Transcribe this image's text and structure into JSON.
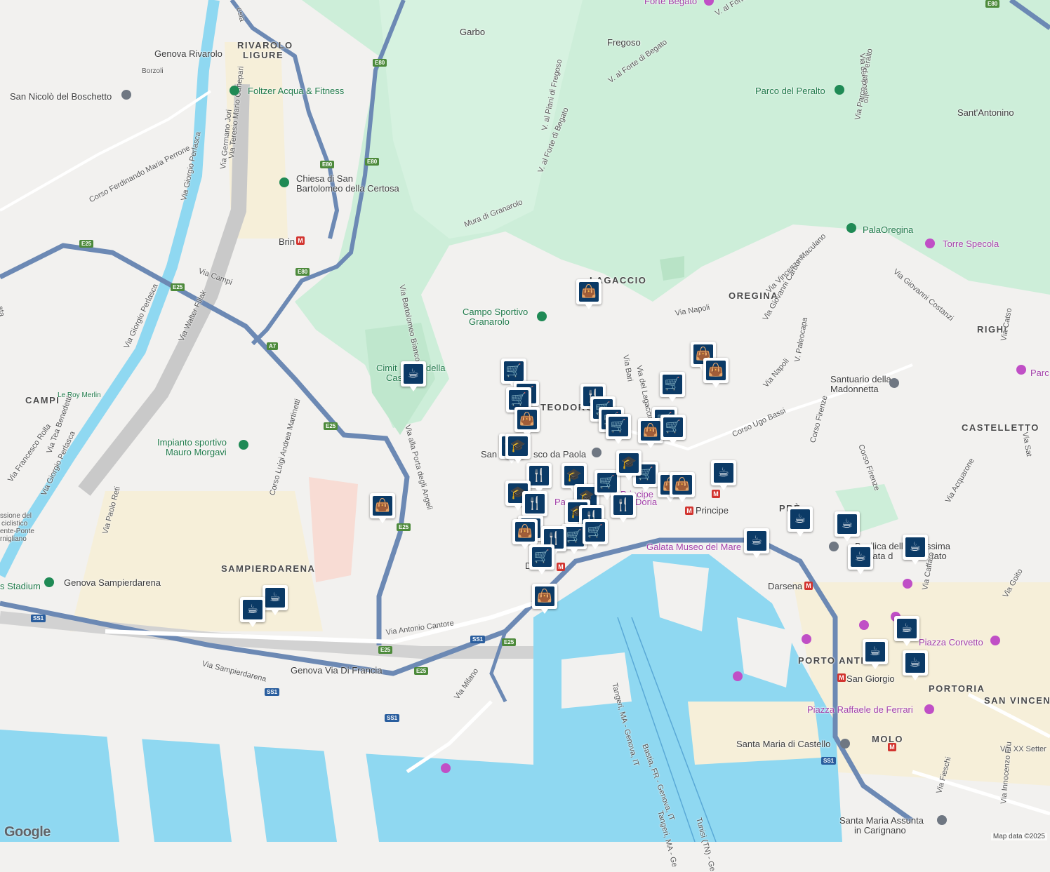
{
  "map": {
    "colors": {
      "land": "#f2f1ef",
      "park": "#c8ecd6",
      "water": "#8ed8f0",
      "highway": "#6f8fb8",
      "major_road": "#ffffff",
      "urban": "#f5efdc"
    },
    "labels": [
      {
        "id": "garbo",
        "text": "Garbo",
        "kind": "place"
      },
      {
        "id": "fregoso",
        "text": "Fregoso",
        "kind": "place"
      },
      {
        "id": "forte-begato",
        "text": "Forte Begato",
        "kind": "purple"
      },
      {
        "id": "rivarolo",
        "text": "RIVAROLO",
        "kind": "area"
      },
      {
        "id": "ligure",
        "text": "LIGURE",
        "kind": "area"
      },
      {
        "id": "genova-rivarolo",
        "text": "Genova Rivarolo",
        "kind": "place"
      },
      {
        "id": "borzoli",
        "text": "Borzoli",
        "kind": "small"
      },
      {
        "id": "san-nicolo",
        "text": "San Nicolò del Boschetto",
        "kind": "place"
      },
      {
        "id": "foltzer",
        "text": "Foltzer Acqua & Fitness",
        "kind": "green"
      },
      {
        "id": "chiesa1",
        "text": "Chiesa di San",
        "kind": "place"
      },
      {
        "id": "chiesa2",
        "text": "Bartolomeo della Certosa",
        "kind": "place"
      },
      {
        "id": "brin",
        "text": "Brin",
        "kind": "place"
      },
      {
        "id": "parco-peralto",
        "text": "Parco del Peralto",
        "kind": "green"
      },
      {
        "id": "sant-antonino",
        "text": "Sant'Antonino",
        "kind": "place"
      },
      {
        "id": "palaoregina",
        "text": "PalaOregina",
        "kind": "green"
      },
      {
        "id": "torre-specola",
        "text": "Torre Specola",
        "kind": "purple"
      },
      {
        "id": "lagaccio",
        "text": "LAGACCIO",
        "kind": "area"
      },
      {
        "id": "oregina",
        "text": "OREGINA",
        "kind": "area"
      },
      {
        "id": "righi",
        "text": "RIGHI",
        "kind": "area"
      },
      {
        "id": "campo1",
        "text": "Campo Sportivo",
        "kind": "green"
      },
      {
        "id": "campo2",
        "text": "Granarolo",
        "kind": "green"
      },
      {
        "id": "cimit",
        "text": "Cimit",
        "kind": "green"
      },
      {
        "id": "della",
        "text": "della",
        "kind": "green"
      },
      {
        "id": "cas",
        "text": "Cas",
        "kind": "green"
      },
      {
        "id": "campi",
        "text": "CAMPI",
        "kind": "area"
      },
      {
        "id": "leroy",
        "text": "Le Roy Merlin",
        "kind": "small-green"
      },
      {
        "id": "teodoro",
        "text": "TEODORO",
        "kind": "area"
      },
      {
        "id": "santuario1",
        "text": "Santuario della",
        "kind": "place"
      },
      {
        "id": "santuario2",
        "text": "Madonnetta",
        "kind": "place"
      },
      {
        "id": "castelletto",
        "text": "CASTELLETTO",
        "kind": "area"
      },
      {
        "id": "impianto1",
        "text": "Impianto sportivo",
        "kind": "green"
      },
      {
        "id": "impianto2",
        "text": "Mauro Morgavi",
        "kind": "green"
      },
      {
        "id": "san-fran",
        "text": "San",
        "kind": "place"
      },
      {
        "id": "sco-paola",
        "text": "sco da Paola",
        "kind": "place"
      },
      {
        "id": "pa-principe",
        "text": "Pa",
        "kind": "purple"
      },
      {
        "id": "doria",
        "text": "Doria",
        "kind": "purple"
      },
      {
        "id": "principe-top",
        "text": "Principe",
        "kind": "purple"
      },
      {
        "id": "principe",
        "text": "Principe",
        "kind": "place"
      },
      {
        "id": "pre",
        "text": "PRÈ",
        "kind": "area"
      },
      {
        "id": "galata",
        "text": "Galata Museo del Mare",
        "kind": "purple"
      },
      {
        "id": "darsena",
        "text": "Darsena",
        "kind": "place"
      },
      {
        "id": "basilica1",
        "text": "Basilica della",
        "kind": "place"
      },
      {
        "id": "basilica1b",
        "text": "ssima",
        "kind": "place"
      },
      {
        "id": "basilica2",
        "text": "ziata d",
        "kind": "place"
      },
      {
        "id": "basilica2b",
        "text": "tato",
        "kind": "place"
      },
      {
        "id": "sampierdarena",
        "text": "SAMPIERDARENA",
        "kind": "area"
      },
      {
        "id": "stadium",
        "text": "s Stadium",
        "kind": "green"
      },
      {
        "id": "genova-sampierdarena",
        "text": "Genova Sampierdarena",
        "kind": "place"
      },
      {
        "id": "genova-via-francia",
        "text": "Genova Via Di Francia",
        "kind": "place"
      },
      {
        "id": "di-lo",
        "text": "Di",
        "kind": "place"
      },
      {
        "id": "porto-antico",
        "text": "PORTO ANTIC",
        "kind": "area"
      },
      {
        "id": "san-giorgio",
        "text": "San Giorgio",
        "kind": "place"
      },
      {
        "id": "piazza-corvetto",
        "text": "Piazza Corvetto",
        "kind": "purple"
      },
      {
        "id": "portoria",
        "text": "PORTORIA",
        "kind": "area"
      },
      {
        "id": "san-vincenzo",
        "text": "SAN VINCENZ",
        "kind": "area"
      },
      {
        "id": "piazza-ferrari",
        "text": "Piazza Raffaele de Ferrari",
        "kind": "purple"
      },
      {
        "id": "molo",
        "text": "MOLO",
        "kind": "area"
      },
      {
        "id": "santa-maria-castello",
        "text": "Santa Maria di Castello",
        "kind": "place"
      },
      {
        "id": "santa-maria-assunta1",
        "text": "Santa Maria Assunta",
        "kind": "place"
      },
      {
        "id": "santa-maria-assunta2",
        "text": "in Carignano",
        "kind": "place"
      },
      {
        "id": "via-xx",
        "text": "Via XX Setter",
        "kind": "street"
      },
      {
        "id": "parc",
        "text": "Parc",
        "kind": "purple"
      },
      {
        "id": "ssione",
        "text": "ssione del",
        "kind": "small"
      },
      {
        "id": "ciclistico",
        "text": "ciclistico",
        "kind": "small"
      },
      {
        "id": "ponte",
        "text": "ente-Ponte",
        "kind": "small"
      },
      {
        "id": "rnigliano",
        "text": "rnigliano",
        "kind": "small"
      }
    ],
    "streets": [
      {
        "id": "via-antonio-cantore",
        "text": "Via Antonio Cantore"
      },
      {
        "id": "via-sampierdarena",
        "text": "Via Sampierdarena"
      },
      {
        "id": "via-milano",
        "text": "Via Milano"
      },
      {
        "id": "via-campi",
        "text": "Via Campi"
      },
      {
        "id": "via-walter-fillak",
        "text": "Via Walter Fillak"
      },
      {
        "id": "via-giorgio-perlasca-a",
        "text": "Via Giorgio Perlasca"
      },
      {
        "id": "via-giorgio-perlasca-b",
        "text": "Via Giorgio Perlasca"
      },
      {
        "id": "via-giorgio-perlasca-c",
        "text": "Via Giorgio Perlasca"
      },
      {
        "id": "via-germano-jori",
        "text": "Via Germano Jori"
      },
      {
        "id": "via-teresio",
        "text": "Via Teresio Mario Canepari"
      },
      {
        "id": "corso-ferdinando",
        "text": "Corso Ferdinando Maria Perrone"
      },
      {
        "id": "via-paolo-reti",
        "text": "Via Paolo Reti"
      },
      {
        "id": "via-tea-benedetti",
        "text": "Via Tea Benedetti"
      },
      {
        "id": "via-francesco-rolla",
        "text": "Via Francesco Rolla"
      },
      {
        "id": "corso-martinetti",
        "text": "Corso Luigi Andrea Martinetti"
      },
      {
        "id": "via-porta-angeli",
        "text": "Via alla Porta degli Angeli"
      },
      {
        "id": "via-bartolomeo-bianco",
        "text": "Via Bartolomeo Bianco"
      },
      {
        "id": "mura-granarolo",
        "text": "Mura di Granarolo"
      },
      {
        "id": "v-piani-fregoso",
        "text": "V. al Piani di Fregoso"
      },
      {
        "id": "v-forte-begato-a",
        "text": "V. al Forte di Begato"
      },
      {
        "id": "v-forte-begato-b",
        "text": "V. al Forte di Begato"
      },
      {
        "id": "v-forte-top",
        "text": "V. al Forte d"
      },
      {
        "id": "via-del-peralto",
        "text": "Via del Peralto"
      },
      {
        "id": "via-parco-peralto",
        "text": "Via Parco del Peralto"
      },
      {
        "id": "via-napoli-a",
        "text": "Via Napoli"
      },
      {
        "id": "via-napoli-b",
        "text": "Via Napoli"
      },
      {
        "id": "via-bari",
        "text": "Via Bari"
      },
      {
        "id": "via-del-lagaccio",
        "text": "Via del Lagaccio"
      },
      {
        "id": "via-vincenzo-maculano",
        "text": "Via Vincenzo Maculano"
      },
      {
        "id": "via-giovanni-carbone",
        "text": "Via Giovanni Carbone"
      },
      {
        "id": "via-paleocapa",
        "text": "V. Paleocapa"
      },
      {
        "id": "corso-ugo-bassi",
        "text": "Corso Ugo Bassi"
      },
      {
        "id": "corso-firenze-a",
        "text": "Corso Firenze"
      },
      {
        "id": "corso-firenze-b",
        "text": "Corso Firenze"
      },
      {
        "id": "via-giovanni-costanzi",
        "text": "Via Giovanni Costanzi"
      },
      {
        "id": "via-caffaro",
        "text": "Via Caffaro"
      },
      {
        "id": "via-acquarone",
        "text": "Via Acquarone"
      },
      {
        "id": "via-goito",
        "text": "Via Goito"
      },
      {
        "id": "via-fieschi",
        "text": "Via Fieschi"
      },
      {
        "id": "via-innocenzo",
        "text": "Via Innocenzo Fru"
      },
      {
        "id": "via-cats",
        "text": "Via Catso"
      },
      {
        "id": "ferry-tangeri-genova",
        "text": "Tangeri, MA - Genova, IT"
      },
      {
        "id": "ferry-bastia",
        "text": "Bastia, FR - Genova, IT"
      },
      {
        "id": "ferry-tunisi",
        "text": "Tunisi (TN) - Ge"
      },
      {
        "id": "ferry-tangeri-ge",
        "text": "Tangeri, MA - Ge"
      },
      {
        "id": "via-sat",
        "text": "Via Sat"
      },
      {
        "id": "esia",
        "text": "esia"
      },
      {
        "id": "ata",
        "text": "ata"
      }
    ],
    "shields": [
      {
        "id": "e80-a",
        "text": "E80"
      },
      {
        "id": "e80-b",
        "text": "E80"
      },
      {
        "id": "e80-c",
        "text": "E80"
      },
      {
        "id": "e80-d",
        "text": "E80"
      },
      {
        "id": "e25-a",
        "text": "E25"
      },
      {
        "id": "e25-b",
        "text": "E25"
      },
      {
        "id": "e25-c",
        "text": "E25"
      },
      {
        "id": "e25-d",
        "text": "E25"
      },
      {
        "id": "e25-e",
        "text": "E25"
      },
      {
        "id": "e25-f",
        "text": "E25"
      },
      {
        "id": "e25-g",
        "text": "E25"
      },
      {
        "id": "a7",
        "text": "A7"
      },
      {
        "id": "ss1-a",
        "text": "SS1"
      },
      {
        "id": "ss1-b",
        "text": "SS1"
      },
      {
        "id": "ss1-c",
        "text": "SS1"
      },
      {
        "id": "ss1-d",
        "text": "SS1"
      },
      {
        "id": "ss1-e",
        "text": "SS1"
      },
      {
        "id": "e80-top",
        "text": "E80"
      }
    ],
    "markers": [
      {
        "type": "bag"
      },
      {
        "type": "cup"
      },
      {
        "type": "cart"
      },
      {
        "type": "cart"
      },
      {
        "type": "cart"
      },
      {
        "type": "bag"
      },
      {
        "type": "bag"
      },
      {
        "type": "cart"
      },
      {
        "type": "fork"
      },
      {
        "type": "cart"
      },
      {
        "type": "cart"
      },
      {
        "type": "cart"
      },
      {
        "type": "cart"
      },
      {
        "type": "bag"
      },
      {
        "type": "school"
      },
      {
        "type": "school"
      },
      {
        "type": "fork"
      },
      {
        "type": "school"
      },
      {
        "type": "school"
      },
      {
        "type": "cart"
      },
      {
        "type": "school"
      },
      {
        "type": "cart"
      },
      {
        "type": "bag"
      },
      {
        "type": "bag"
      },
      {
        "type": "cup"
      },
      {
        "type": "school"
      },
      {
        "type": "fork"
      },
      {
        "type": "school"
      },
      {
        "type": "fork"
      },
      {
        "type": "fork"
      },
      {
        "type": "school"
      },
      {
        "type": "cart"
      },
      {
        "type": "bag"
      },
      {
        "type": "fork"
      },
      {
        "type": "cart"
      },
      {
        "type": "cart"
      },
      {
        "type": "bag"
      },
      {
        "type": "bag"
      },
      {
        "type": "cup"
      },
      {
        "type": "cup"
      },
      {
        "type": "cup"
      },
      {
        "type": "cup"
      },
      {
        "type": "cup"
      },
      {
        "type": "cup"
      },
      {
        "type": "cup"
      },
      {
        "type": "cup"
      },
      {
        "type": "cup"
      },
      {
        "type": "cup"
      },
      {
        "type": "bag"
      },
      {
        "type": "cart"
      }
    ],
    "icons": {
      "cart": "🛒",
      "bag": "👜",
      "cup": "☕",
      "fork": "🍴",
      "school": "🎓"
    }
  },
  "attribution": "Map data ©2025",
  "logo": "Google"
}
